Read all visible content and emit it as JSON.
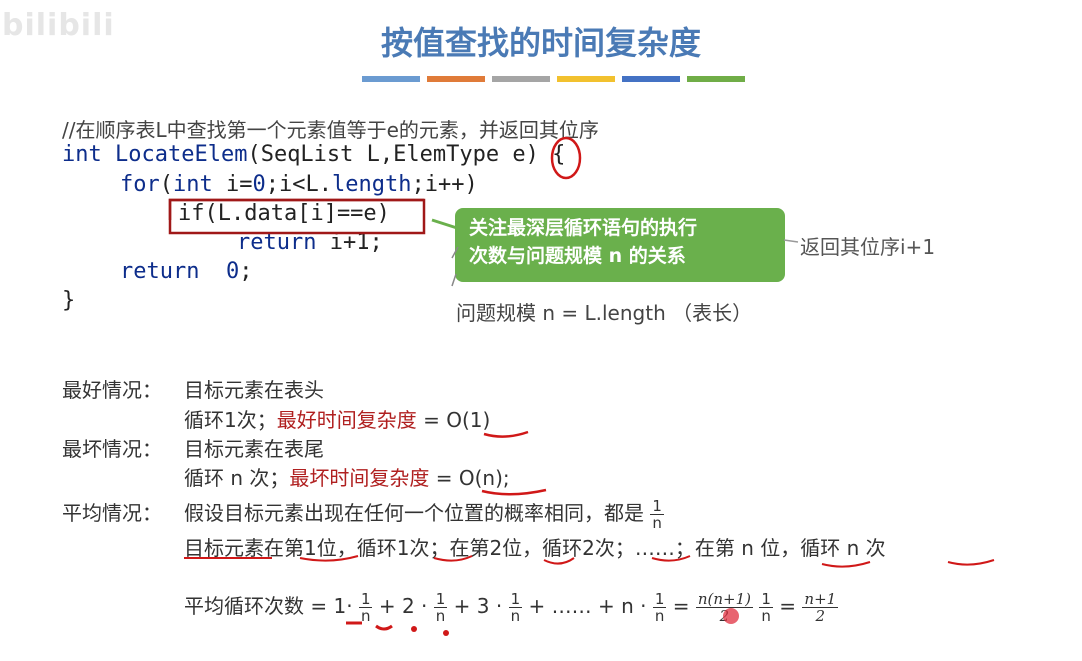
{
  "watermark": "bilibili",
  "title": "按值查找的时间复杂度",
  "title_bar_colors": [
    "#6b9bd1",
    "#e07b39",
    "#a5a5a5",
    "#f2c12e",
    "#4472c4",
    "#70ad47"
  ],
  "code": {
    "comment": "//在顺序表L中查找第一个元素值等于e的元素，并返回其位序",
    "line1_type": "int",
    "line1_fn": "LocateElem",
    "line1_params": "(SeqList L,ElemType ",
    "line1_param_e": "e",
    "line1_end": ") {",
    "line2_for": "for",
    "line2_rest_a": "(",
    "line2_int": "int",
    "line2_rest_b": " i=",
    "line2_zero": "0",
    "line2_rest_c": ";i<L.",
    "line2_length": "length",
    "line2_rest_d": ";i++)",
    "line3": "if(L.data[i]==e)",
    "line4_return": "return",
    "line4_val": " i+1;",
    "line5_return": "return",
    "line5_val": "0",
    "line5_end": ";",
    "line6": "}"
  },
  "callout": {
    "line1": "关注最深层循环语句的执行",
    "line2": "次数与问题规模 n 的关系"
  },
  "return_note": "返回其位序i+1",
  "problem_size": "问题规模 n = L.length （表长）",
  "cases": {
    "best_label": "最好情况：",
    "best_desc": "目标元素在表头",
    "best_loop": "循环1次；",
    "best_complexity_label": "最好时间复杂度",
    "best_complexity_value": " = O(1)",
    "worst_label": "最坏情况：",
    "worst_desc": "目标元素在表尾",
    "worst_loop": "循环 n 次；",
    "worst_complexity_label": "最坏时间复杂度",
    "worst_complexity_value": " = O(n);",
    "avg_label": "平均情况：",
    "avg_desc": "假设目标元素出现在任何一个位置的概率相同，都是",
    "avg_prob_num": "1",
    "avg_prob_den": "n",
    "avg_line2": "目标元素在第1位，循环1次；在第2位，循环2次；……；在第 n 位，循环 n 次",
    "avg_formula_label": "平均循环次数 = ",
    "f_t1": "1·",
    "f_t2": " + 2 ·",
    "f_t3": " + 3 ·",
    "f_t4": " + …… + n ·",
    "f_eq1": " = ",
    "f_big_num": "n(n+1)",
    "f_big_den": "2",
    "f_eq2": " = ",
    "f_res_num": "n+1",
    "f_res_den": "2"
  }
}
